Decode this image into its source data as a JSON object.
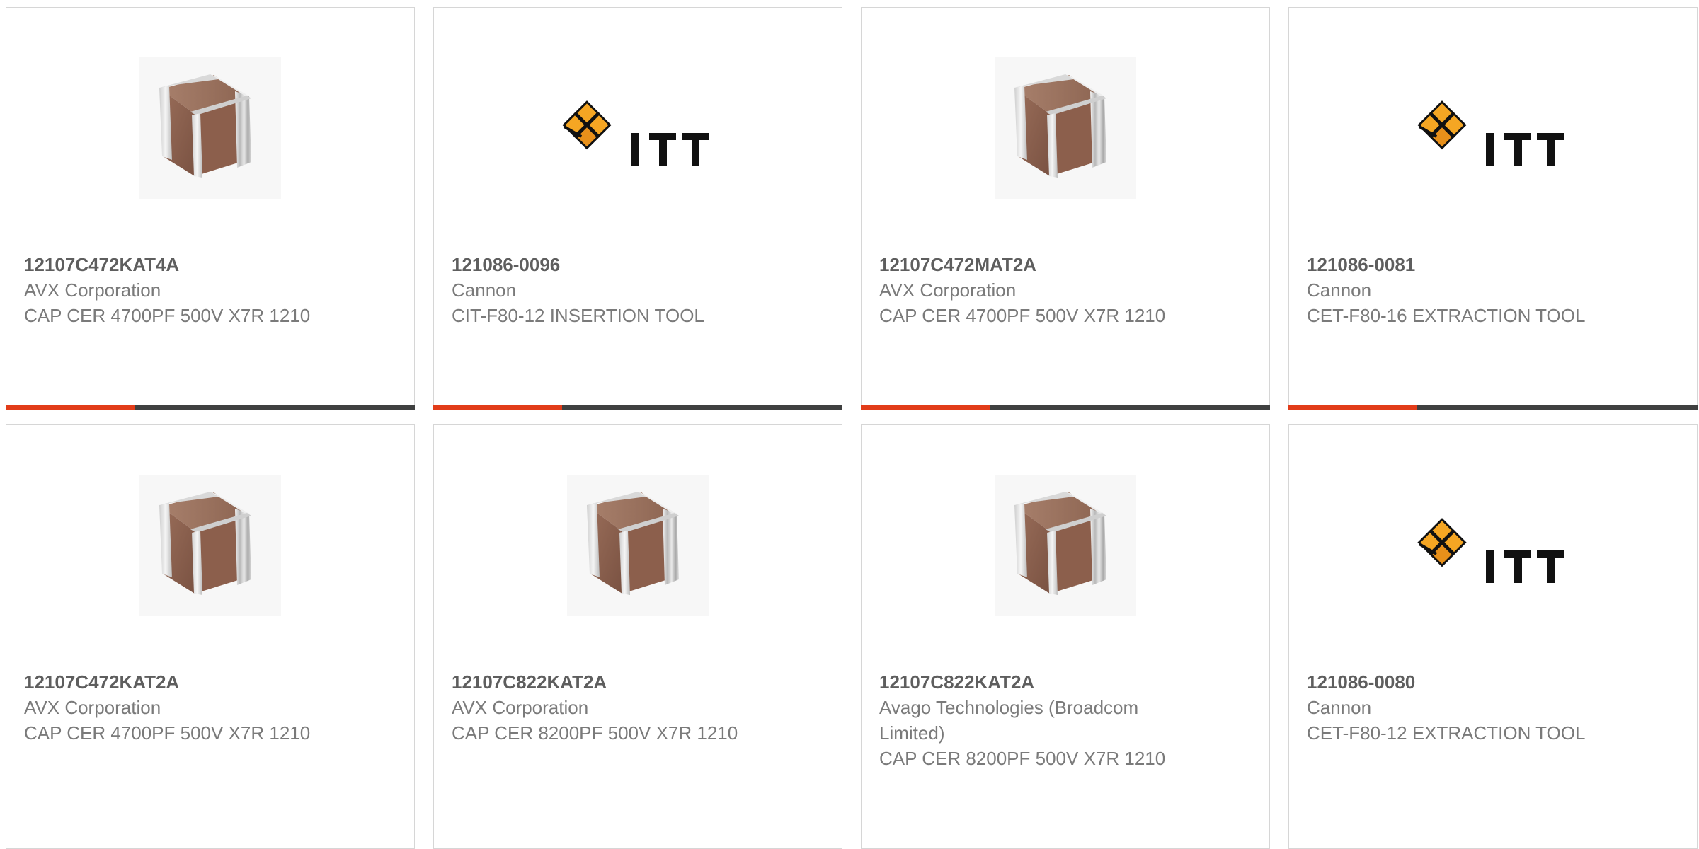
{
  "colors": {
    "accent": "#e23c19",
    "bar": "#3f4040",
    "border": "#d6d6d6",
    "part_number": "#5e5e5e",
    "text": "#7a7a7a"
  },
  "products": [
    {
      "part_number": "12107C472KAT4A",
      "manufacturer": "AVX Corporation",
      "description": "CAP CER 4700PF 500V X7R 1210",
      "image": "ceramic-capacitor-icon"
    },
    {
      "part_number": "121086-0096",
      "manufacturer": "Cannon",
      "description": "CIT-F80-12 INSERTION TOOL",
      "image": "itt-logo"
    },
    {
      "part_number": "12107C472MAT2A",
      "manufacturer": "AVX Corporation",
      "description": "CAP CER 4700PF 500V X7R 1210",
      "image": "ceramic-capacitor-icon"
    },
    {
      "part_number": "121086-0081",
      "manufacturer": "Cannon",
      "description": "CET-F80-16 EXTRACTION TOOL",
      "image": "itt-logo"
    },
    {
      "part_number": "12107C472KAT2A",
      "manufacturer": "AVX Corporation",
      "description": "CAP CER 4700PF 500V X7R 1210",
      "image": "ceramic-capacitor-icon"
    },
    {
      "part_number": "12107C822KAT2A",
      "manufacturer": "AVX Corporation",
      "description": "CAP CER 8200PF 500V X7R 1210",
      "image": "ceramic-capacitor-icon"
    },
    {
      "part_number": "12107C822KAT2A",
      "manufacturer": "Avago Technologies (Broadcom Limited)",
      "description": "CAP CER 8200PF 500V X7R 1210",
      "image": "ceramic-capacitor-icon"
    },
    {
      "part_number": "121086-0080",
      "manufacturer": "Cannon",
      "description": "CET-F80-12 EXTRACTION TOOL",
      "image": "itt-logo"
    }
  ]
}
